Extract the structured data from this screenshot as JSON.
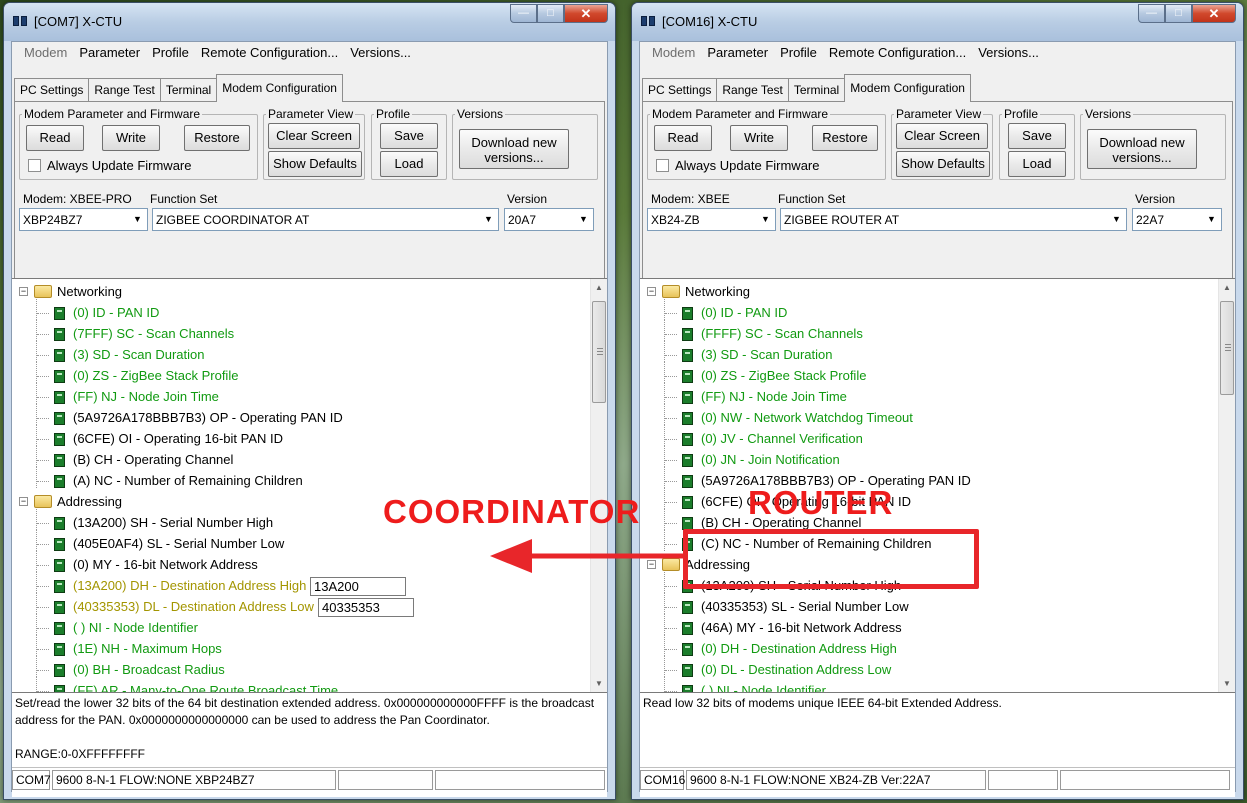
{
  "left": {
    "title": "[COM7] X-CTU",
    "menu": [
      "Modem",
      "Parameter",
      "Profile",
      "Remote Configuration...",
      "Versions..."
    ],
    "tabs": [
      "PC Settings",
      "Range Test",
      "Terminal",
      "Modem Configuration"
    ],
    "groups": {
      "modem_param": "Modem Parameter and Firmware",
      "param_view": "Parameter View",
      "profile": "Profile",
      "versions": "Versions"
    },
    "buttons": {
      "read": "Read",
      "write": "Write",
      "restore": "Restore",
      "clear": "Clear Screen",
      "defaults": "Show Defaults",
      "save": "Save",
      "load": "Load",
      "download": "Download new versions..."
    },
    "always_update": "Always Update Firmware",
    "modem_label": "Modem: XBEE-PRO",
    "function_label": "Function Set",
    "version_label": "Version",
    "modem_value": "XBP24BZ7",
    "function_value": "ZIGBEE COORDINATOR AT",
    "version_value": "20A7",
    "tree": [
      {
        "kind": "folder",
        "text": "Networking"
      },
      {
        "kind": "param",
        "text": "(0) ID - PAN ID",
        "color": "green"
      },
      {
        "kind": "param",
        "text": "(7FFF) SC - Scan Channels",
        "color": "green"
      },
      {
        "kind": "param",
        "text": "(3) SD - Scan Duration",
        "color": "green"
      },
      {
        "kind": "param",
        "text": "(0) ZS - ZigBee Stack Profile",
        "color": "green"
      },
      {
        "kind": "param",
        "text": "(FF) NJ - Node Join Time",
        "color": "green"
      },
      {
        "kind": "param",
        "text": "(5A9726A178BBB7B3) OP - Operating PAN ID",
        "color": "black"
      },
      {
        "kind": "param",
        "text": "(6CFE) OI - Operating 16-bit PAN ID",
        "color": "black"
      },
      {
        "kind": "param",
        "text": "(B) CH - Operating Channel",
        "color": "black"
      },
      {
        "kind": "param",
        "text": "(A) NC - Number of Remaining Children",
        "color": "black"
      },
      {
        "kind": "folder",
        "text": "Addressing"
      },
      {
        "kind": "param",
        "text": "(13A200) SH - Serial Number High",
        "color": "black"
      },
      {
        "kind": "param",
        "text": "(405E0AF4) SL - Serial Number Low",
        "color": "black"
      },
      {
        "kind": "param",
        "text": "(0) MY - 16-bit Network Address",
        "color": "black"
      },
      {
        "kind": "param",
        "text": "(13A200) DH - Destination Address High",
        "color": "olive",
        "edit": "13A200"
      },
      {
        "kind": "param",
        "text": "(40335353) DL - Destination Address Low",
        "color": "olive",
        "edit": "40335353"
      },
      {
        "kind": "param",
        "text": "( ) NI - Node Identifier",
        "color": "green"
      },
      {
        "kind": "param",
        "text": "(1E) NH - Maximum Hops",
        "color": "green"
      },
      {
        "kind": "param",
        "text": "(0) BH - Broadcast Radius",
        "color": "green"
      },
      {
        "kind": "param",
        "text": "(FF) AR - Many-to-One Route Broadcast Time",
        "color": "green"
      }
    ],
    "description": "Set/read the lower 32 bits of the 64 bit destination extended address. 0x000000000000FFFF is the broadcast address for the PAN. 0x0000000000000000 can be used to address the Pan Coordinator.",
    "range": "RANGE:0-0XFFFFFFFF",
    "status": [
      "COM7",
      "9600 8-N-1  FLOW:NONE   XBP24BZ7",
      "",
      ""
    ]
  },
  "right": {
    "title": "[COM16] X-CTU",
    "menu": [
      "Modem",
      "Parameter",
      "Profile",
      "Remote Configuration...",
      "Versions..."
    ],
    "tabs": [
      "PC Settings",
      "Range Test",
      "Terminal",
      "Modem Configuration"
    ],
    "groups": {
      "modem_param": "Modem Parameter and Firmware",
      "param_view": "Parameter View",
      "profile": "Profile",
      "versions": "Versions"
    },
    "buttons": {
      "read": "Read",
      "write": "Write",
      "restore": "Restore",
      "clear": "Clear Screen",
      "defaults": "Show Defaults",
      "save": "Save",
      "load": "Load",
      "download": "Download new versions..."
    },
    "always_update": "Always Update Firmware",
    "modem_label": "Modem: XBEE",
    "function_label": "Function Set",
    "version_label": "Version",
    "modem_value": "XB24-ZB",
    "function_value": "ZIGBEE ROUTER AT",
    "version_value": "22A7",
    "tree": [
      {
        "kind": "folder",
        "text": "Networking"
      },
      {
        "kind": "param",
        "text": "(0) ID - PAN ID",
        "color": "green"
      },
      {
        "kind": "param",
        "text": "(FFFF) SC - Scan Channels",
        "color": "green"
      },
      {
        "kind": "param",
        "text": "(3) SD - Scan Duration",
        "color": "green"
      },
      {
        "kind": "param",
        "text": "(0) ZS - ZigBee Stack Profile",
        "color": "green"
      },
      {
        "kind": "param",
        "text": "(FF) NJ - Node Join Time",
        "color": "green"
      },
      {
        "kind": "param",
        "text": "(0) NW - Network Watchdog Timeout",
        "color": "green"
      },
      {
        "kind": "param",
        "text": "(0) JV - Channel Verification",
        "color": "green"
      },
      {
        "kind": "param",
        "text": "(0) JN - Join Notification",
        "color": "green"
      },
      {
        "kind": "param",
        "text": "(5A9726A178BBB7B3) OP - Operating PAN ID",
        "color": "black"
      },
      {
        "kind": "param",
        "text": "(6CFE) OI - Operating 16-bit PAN ID",
        "color": "black"
      },
      {
        "kind": "param",
        "text": "(B) CH - Operating Channel",
        "color": "black"
      },
      {
        "kind": "param",
        "text": "(C) NC - Number of Remaining Children",
        "color": "black"
      },
      {
        "kind": "folder",
        "text": "Addressing"
      },
      {
        "kind": "param",
        "text": "(13A200) SH - Serial Number High",
        "color": "black"
      },
      {
        "kind": "param",
        "text": "(40335353) SL - Serial Number Low",
        "color": "black"
      },
      {
        "kind": "param",
        "text": "(46A) MY - 16-bit Network Address",
        "color": "black"
      },
      {
        "kind": "param",
        "text": "(0) DH - Destination Address High",
        "color": "green"
      },
      {
        "kind": "param",
        "text": "(0) DL - Destination Address Low",
        "color": "green"
      },
      {
        "kind": "param",
        "text": "( ) NI - Node Identifier",
        "color": "green"
      }
    ],
    "description": "Read low 32 bits of modems unique IEEE 64-bit Extended Address.",
    "range": "",
    "status": [
      "COM16",
      "9600 8-N-1  FLOW:NONE   XB24-ZB  Ver:22A7",
      "",
      ""
    ]
  },
  "annotations": {
    "coordinator_label": "COORDINATOR",
    "router_label": "ROUTER",
    "accent_color": "#e8262a"
  }
}
